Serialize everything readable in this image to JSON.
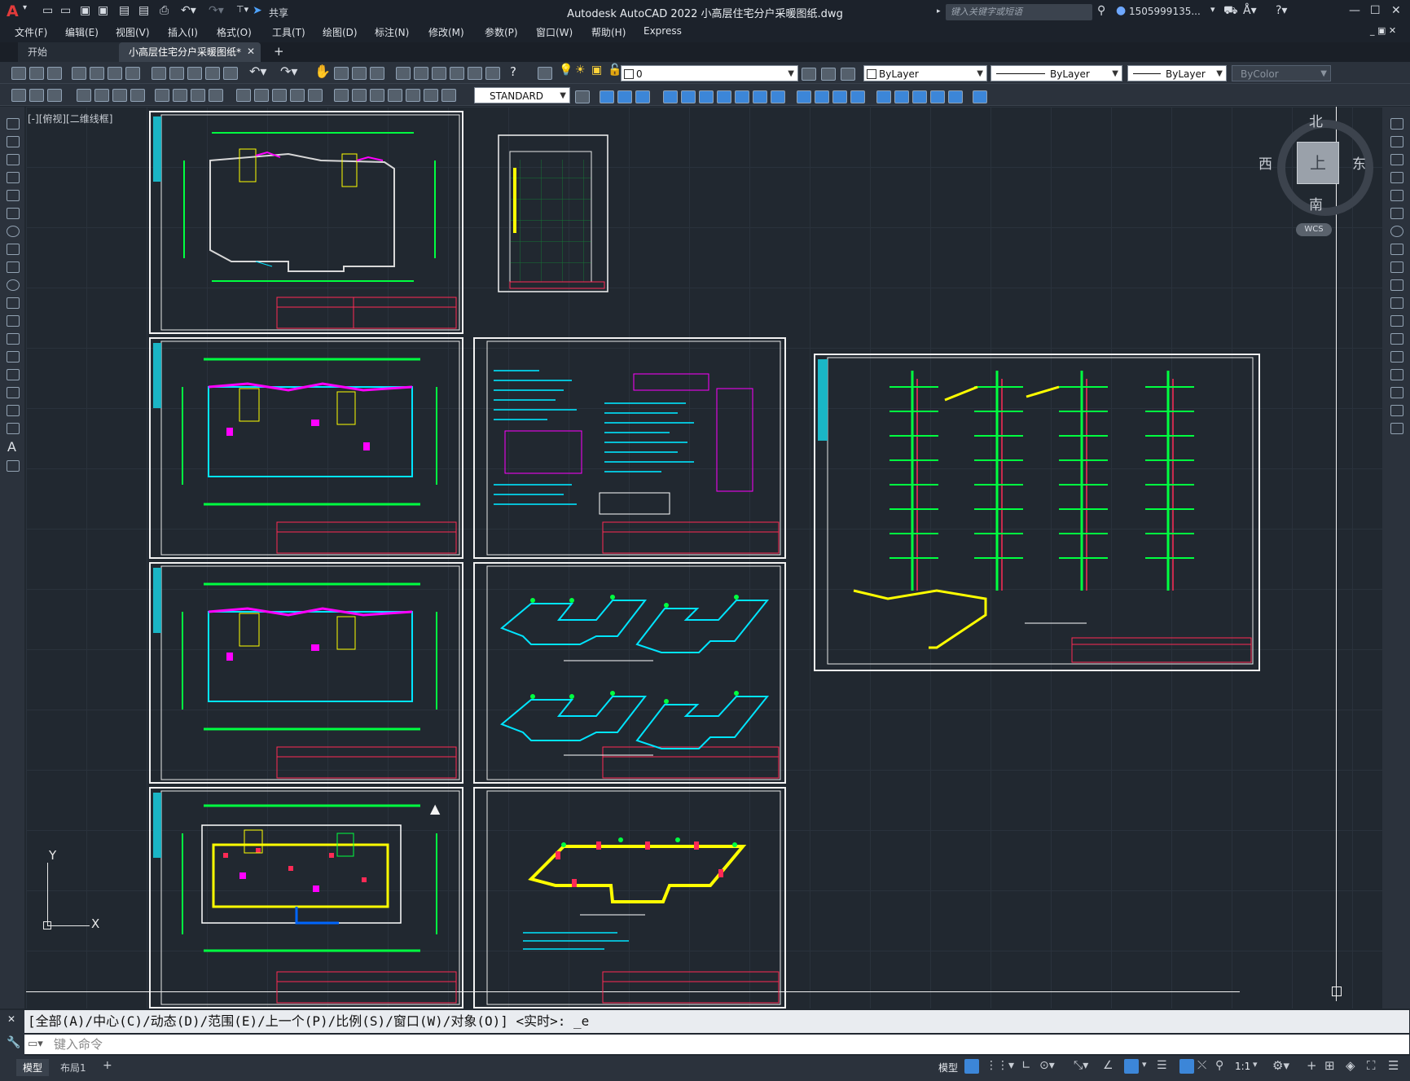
{
  "app": {
    "logo": "A",
    "title": "Autodesk AutoCAD 2022    小高层住宅分户采暖图纸.dwg",
    "share_label": "共享",
    "search_placeholder": "键入关键字或短语",
    "user": "1505999135...",
    "accent": "#e23b3b"
  },
  "menu": [
    "文件(F)",
    "编辑(E)",
    "视图(V)",
    "插入(I)",
    "格式(O)",
    "工具(T)",
    "绘图(D)",
    "标注(N)",
    "修改(M)",
    "参数(P)",
    "窗口(W)",
    "帮助(H)",
    "Express"
  ],
  "tabs": [
    {
      "label": "开始",
      "active": false
    },
    {
      "label": "小高层住宅分户采暖图纸*",
      "active": true
    }
  ],
  "layer": {
    "current": "0"
  },
  "properties": {
    "color": "ByLayer",
    "linetype": "ByLayer",
    "lineweight": "ByLayer",
    "plotstyle": "ByColor"
  },
  "textstyle": "STANDARD",
  "viewport_label": "[-][俯视][二维线框]",
  "viewcube": {
    "north": "北",
    "south": "南",
    "east": "东",
    "west": "西",
    "face": "上",
    "wcs": "WCS"
  },
  "ucs": {
    "x": "X",
    "y": "Y"
  },
  "command": {
    "history": "[全部(A)/中心(C)/动态(D)/范围(E)/上一个(P)/比例(S)/窗口(W)/对象(O)] <实时>: _e",
    "placeholder": "键入命令"
  },
  "layout_tabs": [
    "模型",
    "布局1"
  ],
  "status": {
    "model": "模型",
    "scale": "1:1"
  },
  "colors": {
    "canvas": "#212830",
    "frame": "#f2f2f2",
    "wall": "#ffffff",
    "axis": "#00ff40",
    "pipe_cyan": "#00e5ff",
    "magenta": "#ff00ff",
    "title_block": "#ff2a55",
    "yellow": "#ffff00"
  }
}
